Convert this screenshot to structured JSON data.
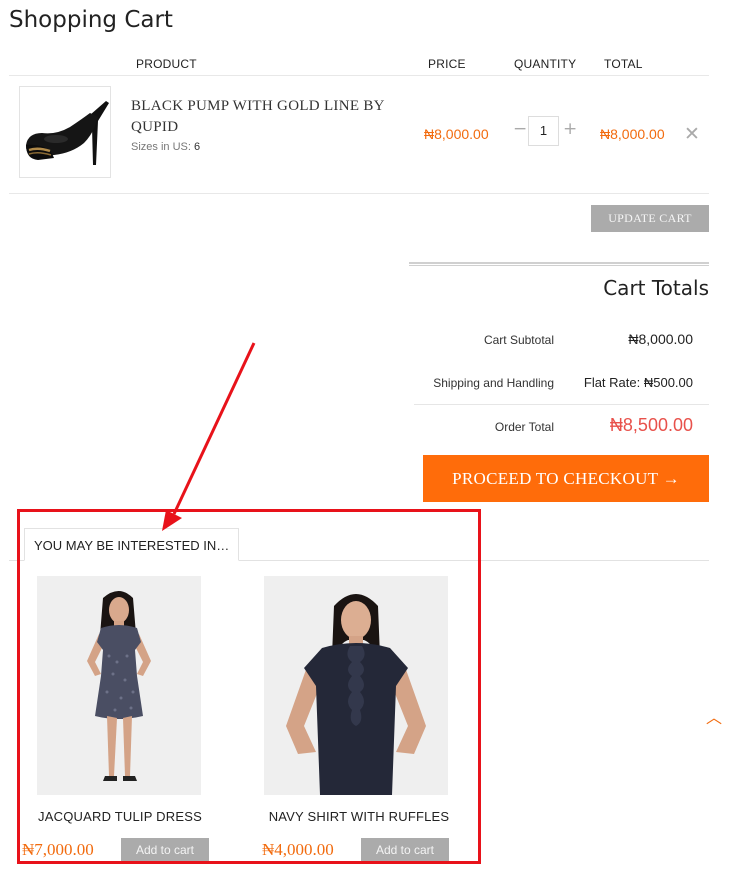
{
  "page": {
    "title": "Shopping Cart"
  },
  "table": {
    "headers": {
      "product": "PRODUCT",
      "price": "PRICE",
      "quantity": "QUANTITY",
      "total": "TOTAL"
    }
  },
  "cart_item": {
    "name": "BLACK PUMP WITH GOLD LINE BY QUPID",
    "size_label": "Sizes in US:",
    "size_value": "6",
    "price": "₦8,000.00",
    "quantity": "1",
    "minus_symbol": "−",
    "plus_symbol": "+",
    "total": "₦8,000.00",
    "remove_symbol": "✕"
  },
  "update_button": "UPDATE CART",
  "totals": {
    "title": "Cart Totals",
    "subtotal_label": "Cart Subtotal",
    "subtotal_value": "₦8,000.00",
    "shipping_label": "Shipping and Handling",
    "shipping_value": "Flat Rate: ₦500.00",
    "order_label": "Order Total",
    "order_value": "₦8,500.00"
  },
  "checkout_button": "PROCEED TO CHECKOUT →",
  "related": {
    "tab_label": "YOU MAY BE INTERESTED IN…",
    "items": [
      {
        "name": "JACQUARD TULIP DRESS",
        "price": "₦7,000.00",
        "button": "Add to cart"
      },
      {
        "name": "NAVY SHIRT WITH RUFFLES",
        "price": "₦4,000.00",
        "button": "Add to cart"
      }
    ]
  },
  "scroll_top_symbol": "︿",
  "icons": {
    "remove": "close-icon",
    "scroll_top": "chevron-up-icon",
    "annotation": "red-arrow-annotation"
  },
  "colors": {
    "accent_orange": "#ff6c0a",
    "price_orange": "#f26b0e",
    "order_total_red": "#e8514b",
    "button_gray": "#ababab",
    "annotation_red": "#e8121a"
  }
}
